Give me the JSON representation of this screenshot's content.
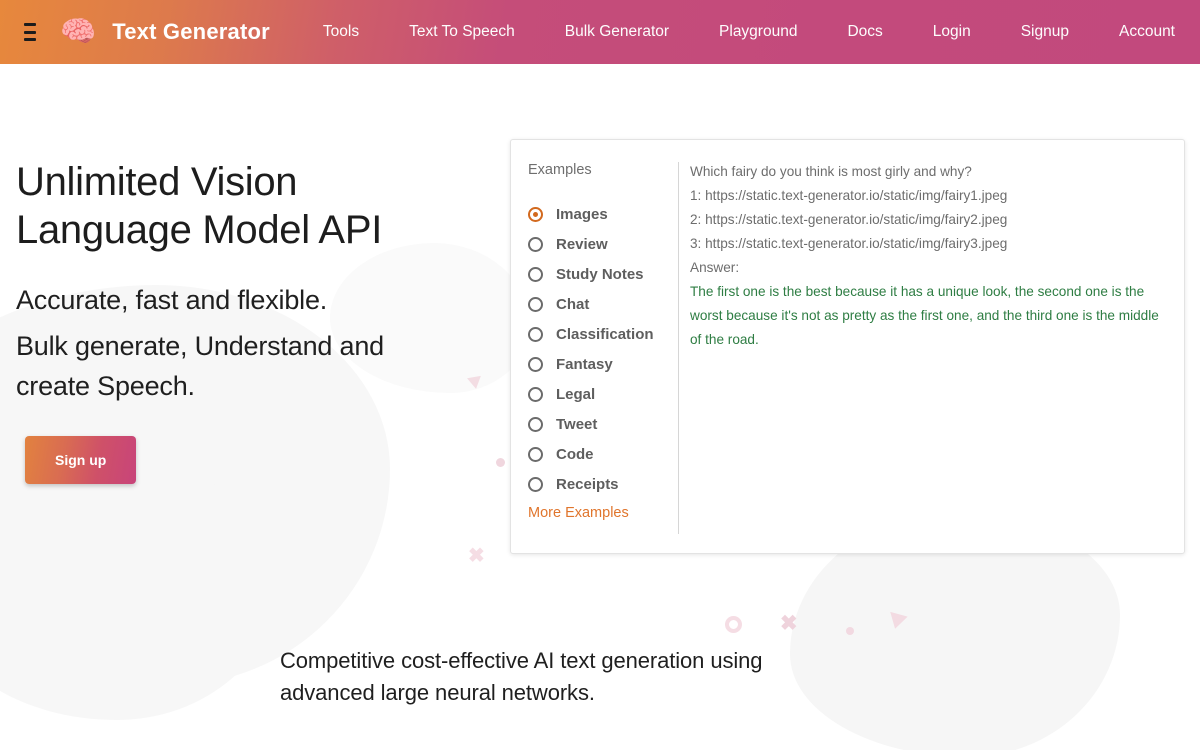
{
  "header": {
    "menu_icon": "hamburger-icon",
    "logo_icon": "🧠",
    "brand": "Text Generator",
    "nav": [
      {
        "label": "Tools"
      },
      {
        "label": "Text To Speech"
      },
      {
        "label": "Bulk Generator"
      },
      {
        "label": "Playground"
      },
      {
        "label": "Docs"
      },
      {
        "label": "Login"
      },
      {
        "label": "Signup"
      },
      {
        "label": "Account"
      }
    ]
  },
  "hero": {
    "title_line1": "Unlimited Vision",
    "title_line2": "Language Model API",
    "subtitle1": "Accurate, fast and flexible.",
    "subtitle2_line1": "Bulk generate, Understand and",
    "subtitle2_line2": "create Speech.",
    "cta_label": "Sign up"
  },
  "examples_card": {
    "title": "Examples",
    "options": [
      {
        "label": "Images",
        "selected": true
      },
      {
        "label": "Review",
        "selected": false
      },
      {
        "label": "Study Notes",
        "selected": false
      },
      {
        "label": "Chat",
        "selected": false
      },
      {
        "label": "Classification",
        "selected": false
      },
      {
        "label": "Fantasy",
        "selected": false
      },
      {
        "label": "Legal",
        "selected": false
      },
      {
        "label": "Tweet",
        "selected": false
      },
      {
        "label": "Code",
        "selected": false
      },
      {
        "label": "Receipts",
        "selected": false
      }
    ],
    "more_link": "More Examples",
    "prompt_lines": [
      "Which fairy do you think is most girly and why?",
      "1: https://static.text-generator.io/static/img/fairy1.jpeg",
      "2: https://static.text-generator.io/static/img/fairy2.jpeg",
      "3: https://static.text-generator.io/static/img/fairy3.jpeg",
      "Answer:"
    ],
    "answer_lines": [
      "The first one is the best because it has a unique look, the second one is the",
      "worst because it's not as pretty as the first one, and the third one is the middle",
      "of the road."
    ]
  },
  "tagline": {
    "line1": "Competitive cost-effective AI text generation using",
    "line2": "advanced large neural networks."
  },
  "colors": {
    "header_gradient_start": "#e7883c",
    "header_gradient_end": "#c2497d",
    "accent_orange": "#d2691e",
    "link_orange": "#e0752c",
    "answer_green": "#2e7d43",
    "text_dark": "#1d1d1d",
    "muted_gray": "#6d6d6d",
    "decorative_pink": "#f5dde4"
  }
}
